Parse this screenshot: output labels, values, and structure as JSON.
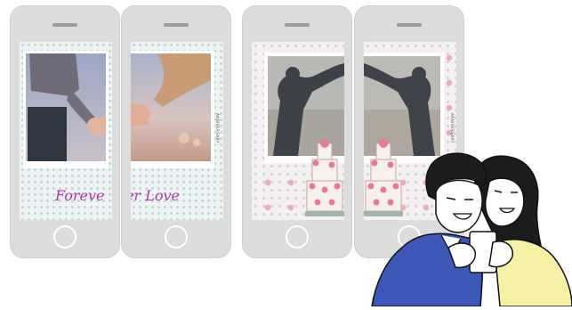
{
  "phones": [
    {
      "caption": "Foreve"
    },
    {
      "caption": "er Love"
    },
    {
      "caption": ""
    },
    {
      "caption": ""
    }
  ],
  "side_text": "ANNIVERSARY",
  "colors": {
    "phone_body": "#dcdcdc",
    "caption_purple": "#b236a8",
    "lace_background": "#eef4f4",
    "floral_background": "#f7f0f2",
    "shirt_blue": "#3b58b8",
    "sweater_yellow": "#f6f1a6"
  },
  "icons": [
    "speaker-grille-icon",
    "home-button-icon"
  ]
}
